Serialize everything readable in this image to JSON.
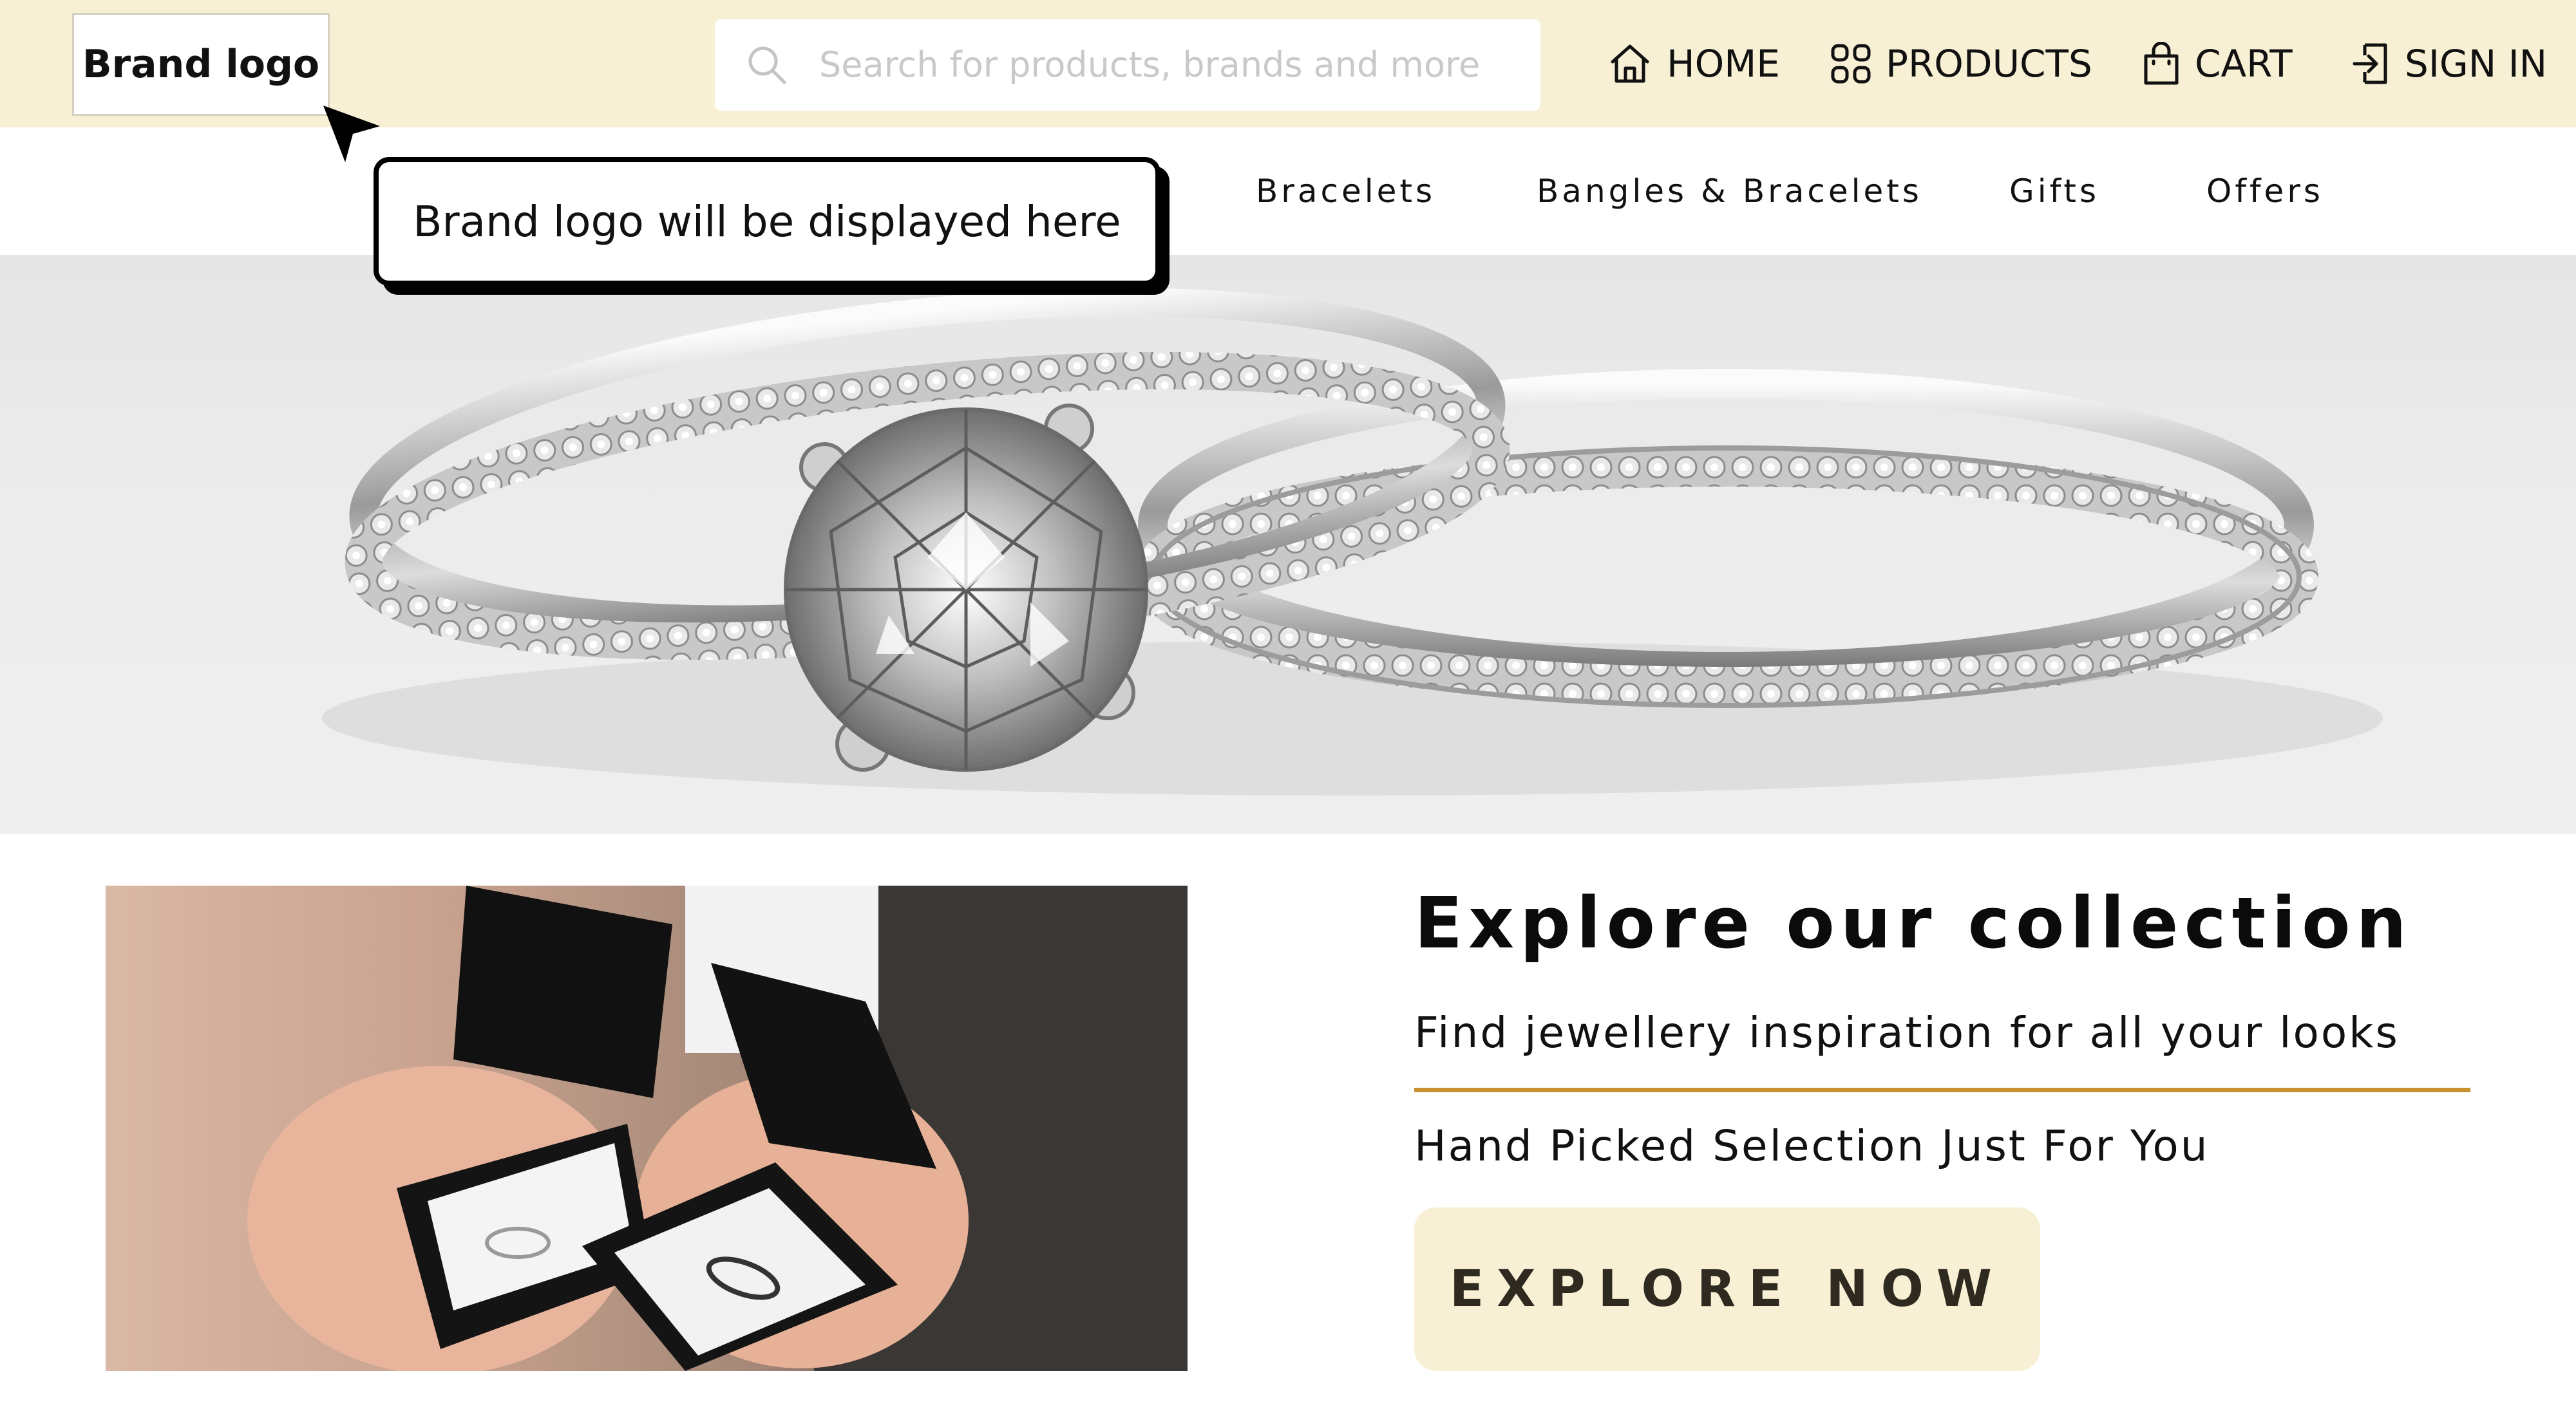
{
  "header": {
    "brand_logo": "Brand logo",
    "search_placeholder": "Search for products, brands and more",
    "nav": {
      "home": "HOME",
      "products": "PRODUCTS",
      "cart": "CART",
      "sign_in": "SIGN IN"
    }
  },
  "categories": [
    "Bracelets",
    "Bangles & Bracelets",
    "Gifts",
    "Offers"
  ],
  "tooltip": {
    "text": "Brand logo will be displayed here"
  },
  "promo": {
    "title": "Explore our collection",
    "subtitle": "Find jewellery inspiration for all your looks",
    "tagline": "Hand Picked Selection Just For You",
    "cta_label": "EXPLORE NOW"
  },
  "images": {
    "hero": "engagement-ring-and-wedding-band-photo",
    "promo_photo": "hands-holding-ring-boxes-photo"
  },
  "colors": {
    "header_bg": "#f8f0d5",
    "accent_line": "#c8902f",
    "cta_bg": "#f8f0d5"
  },
  "icons": [
    "search-icon",
    "home-icon",
    "products-grid-icon",
    "cart-bag-icon",
    "sign-in-icon",
    "pointer-cursor-icon"
  ]
}
